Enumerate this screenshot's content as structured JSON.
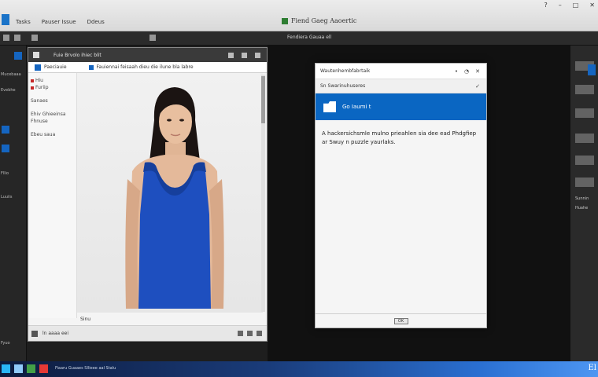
{
  "title_bar": {
    "menu": [
      "Tasks",
      "Pauser Issue",
      "Ddeus"
    ],
    "title": "Fiend Gaeg Aaoertic",
    "window_controls": [
      "?",
      "–",
      "□",
      "✕"
    ]
  },
  "toolbar2": {
    "label": "Fendiera Gauaa ell"
  },
  "left_sidebar": {
    "items": [
      {
        "label": "Mucebaaa"
      },
      {
        "label": "Evebhe"
      },
      {
        "label": "Fllio"
      },
      {
        "label": "Luuiis"
      },
      {
        "label": "Fyuo"
      }
    ]
  },
  "left_window": {
    "title": "Fuie Brvolo ihiec blit",
    "address_nav": "Paeciauie",
    "address_text": "Fauiennai feisaah dieu die ilune bla labre",
    "nav_items": [
      "Hiu",
      "Furiip",
      "Sanaes",
      "Ehiv Ghieeinsa",
      "Fhnuse",
      "Ebeu saua"
    ],
    "caption": "Sinu",
    "status_text": "ln aaaa eei"
  },
  "dialog": {
    "header_title": "Wautenhembfabrtaik",
    "header_controls": [
      "•",
      "◔",
      "✕"
    ],
    "sub_title": "Sn Swarinuhuseres",
    "selected_label": "Go Iaumi t",
    "description": "A hackersichsmle mulno prieahlen sia dee ead Phdgfiep ar Swuy n puzzle yaurlaks.",
    "ok_label": "OK"
  },
  "right_panel": {
    "labels": [
      "Sunnin",
      "Huahe"
    ]
  },
  "taskbar": {
    "text": "Fiaaru Guaaes Sllieee aal Stalu",
    "right_glyph": "El"
  },
  "colors": {
    "accent_blue": "#0a66c2",
    "dark_bg": "#1e1e1e",
    "shirt_blue": "#1e4fbf"
  }
}
